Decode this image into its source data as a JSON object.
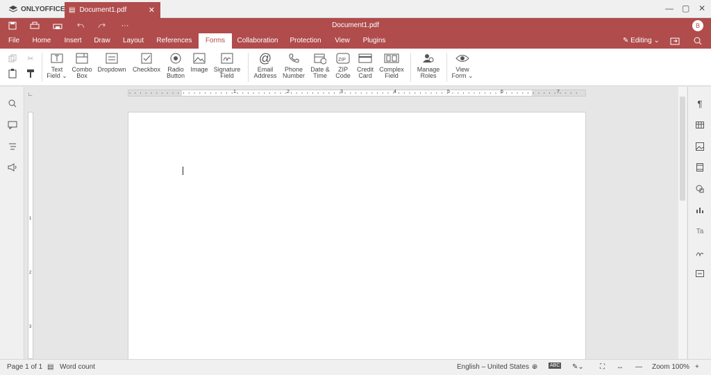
{
  "app": {
    "name": "ONLYOFFICE",
    "tab_title": "Document1.pdf",
    "doc_title": "Document1.pdf",
    "user_initial": "B"
  },
  "menu": [
    "File",
    "Home",
    "Insert",
    "Draw",
    "Layout",
    "References",
    "Forms",
    "Collaboration",
    "Protection",
    "View",
    "Plugins"
  ],
  "active_menu": "Forms",
  "editing": "Editing",
  "tools": {
    "text_field": [
      "Text",
      "Field"
    ],
    "combo_box": [
      "Combo",
      "Box"
    ],
    "dropdown": [
      "Dropdown",
      ""
    ],
    "checkbox": [
      "Checkbox",
      ""
    ],
    "radio_button": [
      "Radio",
      "Button"
    ],
    "image": [
      "Image",
      ""
    ],
    "signature_field": [
      "Signature",
      "Field"
    ],
    "email_address": [
      "Email",
      "Address"
    ],
    "phone_number": [
      "Phone",
      "Number"
    ],
    "date_time": [
      "Date &",
      "Time"
    ],
    "zip_code": [
      "ZIP",
      "Code"
    ],
    "credit_card": [
      "Credit",
      "Card"
    ],
    "complex_field": [
      "Complex",
      "Field"
    ],
    "manage_roles": [
      "Manage",
      "Roles"
    ],
    "view_form": [
      "View",
      "Form"
    ]
  },
  "status": {
    "page": "Page 1 of 1",
    "word_count": "Word count",
    "language": "English – United States",
    "zoom": "Zoom 100%"
  },
  "ruler_numbers": [
    "1",
    "2",
    "3",
    "4",
    "5",
    "6",
    "7"
  ],
  "vruler_numbers": [
    "1",
    "2",
    "3"
  ],
  "accent": "#b04c4c"
}
